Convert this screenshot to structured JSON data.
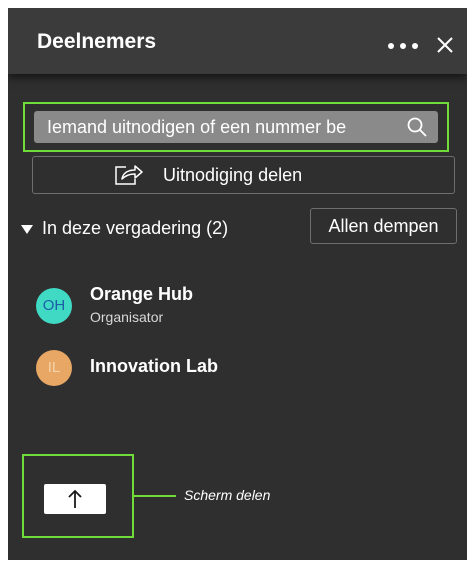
{
  "colors": {
    "panel_bg": "#2f2f2f",
    "header_bg": "#3b3b3b",
    "highlight": "#6fdc3a",
    "search_bg": "#8a8a8a"
  },
  "header": {
    "title": "Deelnemers",
    "more_icon": "ellipsis-icon",
    "close_icon": "close-icon"
  },
  "invite": {
    "placeholder": "Iemand uitnodigen of een nummer be",
    "search_icon": "search-icon"
  },
  "share_invite": {
    "label": "Uitnodiging delen",
    "icon": "share-arrow-icon"
  },
  "meeting": {
    "section_label": "In deze vergadering (2)",
    "mute_all_label": "Allen dempen",
    "participants": [
      {
        "initials": "OH",
        "name": "Orange Hub",
        "role": "Organisator",
        "avatar_bg": "#3fd9c4",
        "avatar_fg": "#1c5fa8"
      },
      {
        "initials": "IL",
        "name": "Innovation Lab",
        "role": "",
        "avatar_bg": "#e8a764",
        "avatar_fg": "#f4d3a8"
      }
    ]
  },
  "share_screen": {
    "icon": "arrow-up-icon",
    "callout": "Scherm delen"
  }
}
